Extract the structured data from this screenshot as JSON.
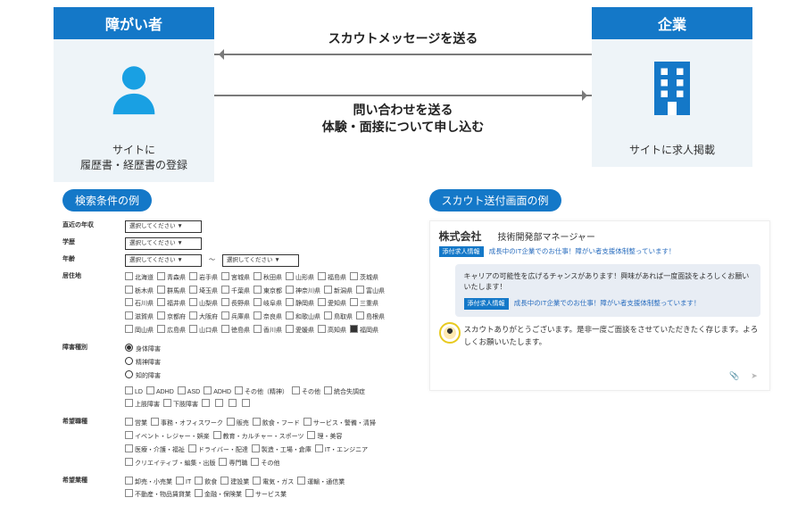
{
  "panels": {
    "left": {
      "title": "障がい者",
      "footer_l1": "サイトに",
      "footer_l2": "履歴書・経歴書の登録"
    },
    "right": {
      "title": "企業",
      "footer": "サイトに求人掲載"
    }
  },
  "arrows": {
    "top": "スカウトメッセージを送る",
    "bottom_l1": "問い合わせを送る",
    "bottom_l2": "体験・面接について申し込む"
  },
  "badges": {
    "search": "検索条件の例",
    "scout": "スカウト送付画面の例"
  },
  "form": {
    "labels": {
      "income": "直近の年収",
      "education": "学歴",
      "age": "年齢",
      "residence": "居住地",
      "disability": "障害種別",
      "job": "希望職種",
      "industry": "希望業種"
    },
    "select_placeholder": "選択してください",
    "range_sep": "〜",
    "residence_opts": [
      "北海道",
      "青森県",
      "岩手県",
      "宮城県",
      "秋田県",
      "山形県",
      "福島県",
      "茨城県",
      "栃木県",
      "群馬県",
      "埼玉県",
      "千葉県",
      "東京都",
      "神奈川県",
      "新潟県",
      "富山県",
      "石川県",
      "福井県",
      "山梨県",
      "長野県",
      "岐阜県",
      "静岡県",
      "愛知県",
      "三重県",
      "滋賀県",
      "京都府",
      "大阪府",
      "兵庫県",
      "奈良県",
      "和歌山県",
      "鳥取県",
      "島根県",
      "岡山県",
      "広島県",
      "山口県",
      "徳島県",
      "香川県",
      "愛媛県",
      "高知県",
      "福岡県"
    ],
    "residence_checked": "福岡県",
    "disability_radios": [
      "身体障害",
      "精神障害",
      "知的障害"
    ],
    "disability_radio_on": "身体障害",
    "disability_chk": [
      "LD",
      "ADHD",
      "ASD",
      "ADHD",
      "その他（精神）",
      "その他",
      "統合失調症",
      "上肢障害",
      "下肢障害",
      "",
      "",
      "",
      ""
    ],
    "job_chk": [
      "営業",
      "事務・オフィスワーク",
      "販売",
      "飲食・フード",
      "サービス・警備・清掃",
      "イベント・レジャー・娯楽",
      "教育・カルチャー・スポーツ",
      "理・美容",
      "医療・介護・福祉",
      "ドライバー・配達",
      "製造・工場・倉庫",
      "IT・エンジニア",
      "クリエイティブ・編集・出版",
      "専門職",
      "その他"
    ],
    "industry_chk": [
      "卸売・小売業",
      "IT",
      "飲食",
      "建設業",
      "電気・ガス",
      "運輸・通信業",
      "不動産・物品賃貸業",
      "金融・保険業",
      "サービス業"
    ]
  },
  "scout": {
    "company": "株式会社",
    "title": "技術開発部マネージャー",
    "tag": "添付求人情報",
    "tagline": "成長中のIT企業でのお仕事！障がい者支援体制整っています！",
    "bubble_l1": "キャリアの可能性を広げるチャンスがあります！興味があれば一度面談をよろしくお願いいたします！",
    "bubble_tag": "添付求人情報",
    "bubble_tagline": "成長中のIT企業でのお仕事！障がい者支援体制整っています！",
    "reply": "スカウトありがとうございます。是非一度ご面談をさせていただきたく存じます。よろしくお願いいたします。"
  }
}
